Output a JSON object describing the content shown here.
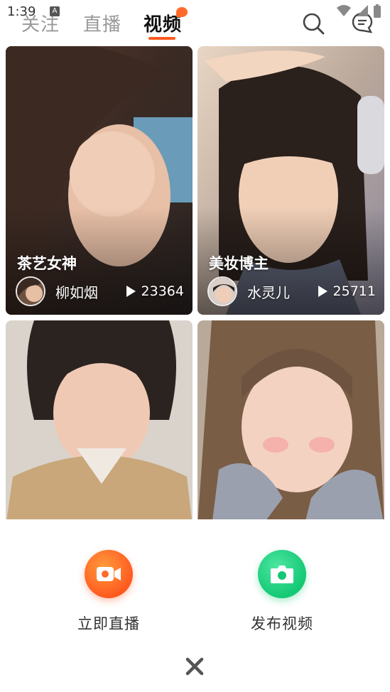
{
  "status_bar": {
    "time": "1:39",
    "notification_icon": "a-icon"
  },
  "tabs": [
    {
      "label": "关注",
      "active": false
    },
    {
      "label": "直播",
      "active": false
    },
    {
      "label": "视频",
      "active": true
    }
  ],
  "top_actions": {
    "search_icon": "search-icon",
    "message_icon": "message-icon"
  },
  "feed": [
    {
      "title": "茶艺女神",
      "author": "柳如烟",
      "plays": "23364"
    },
    {
      "title": "美妆博主",
      "author": "水灵儿",
      "plays": "25711"
    },
    {
      "title": "",
      "author": "",
      "plays": ""
    },
    {
      "title": "",
      "author": "",
      "plays": ""
    }
  ],
  "sheet": {
    "live_label": "立即直播",
    "video_label": "发布视频",
    "close_icon": "close-icon"
  },
  "colors": {
    "accent": "#ff5a1f",
    "green": "#14c874",
    "inactive_tab": "#999999"
  }
}
